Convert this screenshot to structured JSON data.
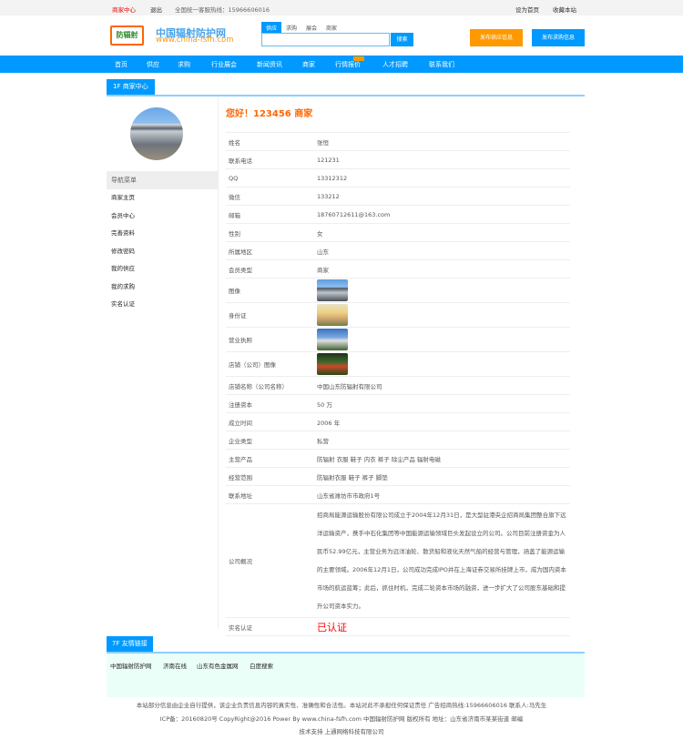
{
  "topbar": {
    "merchant_center": "商家中心",
    "logout": "退出",
    "hotline": "全国统一客服热线：15966606016",
    "set_home": "设为首页",
    "favorite": "收藏本站"
  },
  "header": {
    "logo_text": "防辐射",
    "site_name": "中国辐射防护网",
    "site_url": "www.china-fsfh.com",
    "search_tabs": [
      "供应",
      "求购",
      "展会",
      "商家"
    ],
    "search_value": "",
    "search_button": "搜索",
    "publish_supply": "发布供应信息",
    "publish_purchase": "发布求购信息"
  },
  "nav": {
    "items": [
      "首页",
      "供应",
      "求购",
      "行业展会",
      "新闻资讯",
      "商家",
      "行情报价",
      "人才招聘",
      "联系我们"
    ]
  },
  "section": {
    "title": "1F 商家中心"
  },
  "sidebar": {
    "menu_title": "导航菜单",
    "items": [
      "商家主页",
      "会员中心",
      "完善资料",
      "修改密码",
      "我的供应",
      "我的求购",
      "实名认证"
    ]
  },
  "main": {
    "greeting": "您好！123456 商家",
    "rows": [
      {
        "k": "姓名",
        "v": "张恒"
      },
      {
        "k": "联系电话",
        "v": "121231"
      },
      {
        "k": "QQ",
        "v": "13312312"
      },
      {
        "k": "微信",
        "v": "133212"
      },
      {
        "k": "邮箱",
        "v": "18760712611@163.com"
      },
      {
        "k": "性别",
        "v": "女"
      },
      {
        "k": "所属地区",
        "v": "山东"
      },
      {
        "k": "会员类型",
        "v": "商家"
      }
    ],
    "image_rows": [
      "图像",
      "身份证",
      "营业执照",
      "店铺（公司）图像"
    ],
    "rows2": [
      {
        "k": "店铺名称（公司名称）",
        "v": "中国山东防辐射有限公司"
      },
      {
        "k": "注册资本",
        "v": "50 万"
      },
      {
        "k": "成立时间",
        "v": "2006 年"
      },
      {
        "k": "企业类型",
        "v": "私营"
      },
      {
        "k": "主营产品",
        "v": "防辐射 衣服 鞋子 内衣 裤子 除尘产品 辐射电磁"
      },
      {
        "k": "经营范围",
        "v": "防辐射衣服 鞋子 裤子 脚垫"
      },
      {
        "k": "联系地址",
        "v": "山东省潍坊市市政府1号"
      }
    ],
    "overview_label": "公司概况",
    "overview": "招商局能源运输股份有限公司成立于2004年12月31日，是大型驻港央企招商局集团整合旗下远洋运输资产，携手中石化集团等中国能源运输领域巨头发起设立的公司。公司目前注册资金为人民币52.99亿元，主营业务为远洋油轮、散货船和液化天然气船的经营与管理，涵盖了能源运输的主要领域。2006年12月1日，公司成功完成IPO并在上海证券交易所挂牌上市，成为国内资本市场的航运蓝筹；此后，抓住时机，完成二轮资本市场的融资，进一步扩大了公司股东基础和提升公司资本实力。",
    "cert_label": "实名认证",
    "cert_value": "已认证"
  },
  "friends": {
    "title": "7F 友情链接",
    "links": [
      "中国辐射防护网",
      "济南在线",
      "山东有色金属网",
      "白度搜索"
    ]
  },
  "footer": {
    "line1": "本站部分信息由企业自行提供，该企业负责信息内容的真实性、准确性和合法性。本站对此不承担任何保证责任 广告招商热线:15966606016 联系人:马先生",
    "line2": "ICP备：20160820号 CopyRight@2016 Power By www.china-fsfh.com 中国辐射防护网 版权所有 地址：山东省济南市某某街道 邮编",
    "line3": "技术支持 上通网络科技有限公司"
  },
  "colors": {
    "primary": "#0099ff",
    "accent": "#ff9900",
    "greeting": "#ff6600",
    "cert": "#ff0000"
  }
}
